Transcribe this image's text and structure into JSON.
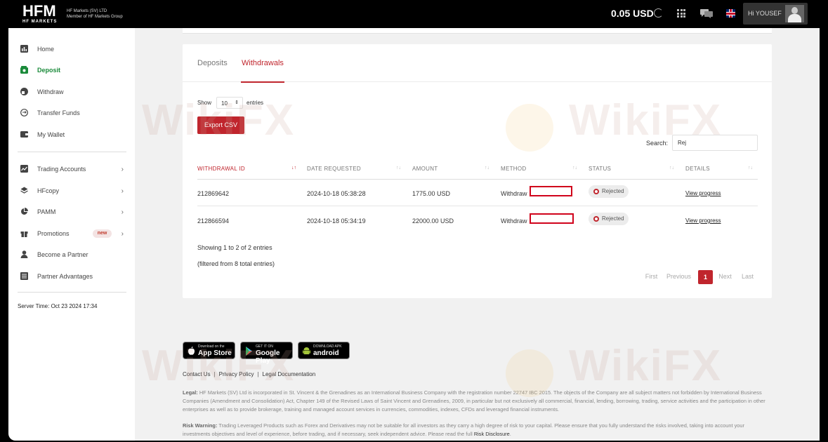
{
  "topbar": {
    "logo_main": "HFM",
    "logo_sub": "HF MARKETS",
    "company_line1": "HF Markets (SV) LTD",
    "company_line2": "Member of HF Markets Group",
    "balance": "0.05 USD",
    "greeting": "Hi YOUSEF"
  },
  "sidebar": {
    "items": [
      {
        "label": "Home"
      },
      {
        "label": "Deposit"
      },
      {
        "label": "Withdraw"
      },
      {
        "label": "Transfer Funds"
      },
      {
        "label": "My Wallet"
      },
      {
        "label": "Trading Accounts"
      },
      {
        "label": "HFcopy"
      },
      {
        "label": "PAMM"
      },
      {
        "label": "Promotions",
        "badge": "new"
      },
      {
        "label": "Become a Partner"
      },
      {
        "label": "Partner Advantages"
      }
    ],
    "server_time": "Server Time: Oct 23 2024 17:34"
  },
  "card": {
    "tabs": [
      "Deposits",
      "Withdrawals"
    ],
    "active_tab": "Withdrawals",
    "show_label": "Show",
    "entries_value": "10",
    "entries_label": "entries",
    "export_label": "Export CSV",
    "search_label": "Search:",
    "search_value": "Rej",
    "columns": [
      "WITHDRAWAL ID",
      "DATE REQUESTED",
      "AMOUNT",
      "METHOD",
      "STATUS",
      "DETAILS"
    ],
    "rows": [
      {
        "id": "212869642",
        "date": "2024-10-18 05:38:28",
        "amount": "1775.00 USD",
        "method": "Withdraw",
        "status": "Rejected",
        "details": "View progress"
      },
      {
        "id": "212866594",
        "date": "2024-10-18 05:34:19",
        "amount": "22000.00 USD",
        "method": "Withdraw",
        "status": "Rejected",
        "details": "View progress"
      }
    ],
    "info": "Showing 1 to 2 of 2 entries",
    "filter_info": "(filtered from 8 total entries)",
    "pagination": {
      "first": "First",
      "previous": "Previous",
      "current": "1",
      "next": "Next",
      "last": "Last"
    }
  },
  "footer": {
    "app_store_small": "Download on the",
    "app_store_big": "App Store",
    "google_small": "GET IT ON",
    "google_big": "Google Play",
    "android_small": "DOWNLOAD APK",
    "android_big": "android",
    "links": [
      "Contact Us",
      "Privacy Policy",
      "Legal Documentation"
    ],
    "legal_label": "Legal:",
    "legal_text": "HF Markets (SV) Ltd is incorporated in St. Vincent & the Grenadines as an International Business Company with the registration number 22747 IBC 2015. The objects of the Company are all subject matters not forbidden by International Business Companies (Amendment and Consolidation) Act, Chapter 149 of the Revised Laws of Saint Vincent and Grenadines, 2009, in particular but not exclusively all commercial, financial, lending, borrowing, trading, service activities and the participation in other enterprises as well as to provide brokerage, training and managed account services in currencies, commodities, indexes, CFDs and leveraged financial instruments.",
    "risk_label": "Risk Warning:",
    "risk_text": "Trading Leveraged Products such as Forex and Derivatives may not be suitable for all investors as they carry a high degree of risk to your capital. Please ensure that you fully understand the risks involved, taking into account your investments objectives and level of experience, before trading, and if necessary, seek independent advice. Please read the full",
    "risk_link": "Risk Disclosure",
    "risk_end": "."
  },
  "watermark": {
    "text": "WikiFX"
  },
  "colors": {
    "accent": "#c0252d",
    "active_nav": "#1a8a3a",
    "topbar": "#000000"
  }
}
